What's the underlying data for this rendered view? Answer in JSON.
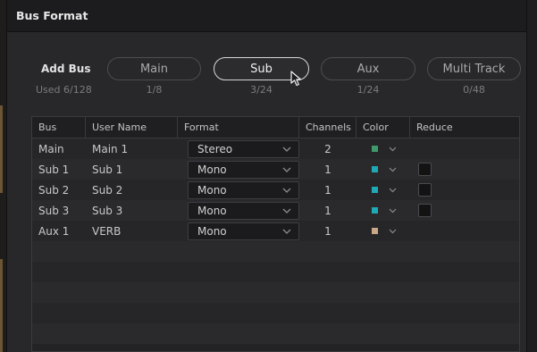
{
  "window": {
    "title": "Bus Format"
  },
  "add_bus": {
    "label": "Add Bus",
    "used": "Used 6/128",
    "buttons": [
      {
        "label": "Main",
        "count": "1/8",
        "active": false
      },
      {
        "label": "Sub",
        "count": "3/24",
        "active": true
      },
      {
        "label": "Aux",
        "count": "1/24",
        "active": false
      },
      {
        "label": "Multi Track",
        "count": "0/48",
        "active": false
      }
    ]
  },
  "table": {
    "headers": [
      "Bus",
      "User Name",
      "Format",
      "Channels",
      "Color",
      "Reduce"
    ],
    "rows": [
      {
        "bus": "Main",
        "user_name": "Main 1",
        "format": "Stereo",
        "channels": "2",
        "color": "#3f9a6a",
        "reduce": false
      },
      {
        "bus": "Sub 1",
        "user_name": "Sub 1",
        "format": "Mono",
        "channels": "1",
        "color": "#1fa9b4",
        "reduce": true
      },
      {
        "bus": "Sub 2",
        "user_name": "Sub 2",
        "format": "Mono",
        "channels": "1",
        "color": "#1fa9b4",
        "reduce": true
      },
      {
        "bus": "Sub 3",
        "user_name": "Sub 3",
        "format": "Mono",
        "channels": "1",
        "color": "#1fa9b4",
        "reduce": true
      },
      {
        "bus": "Aux 1",
        "user_name": "VERB",
        "format": "Mono",
        "channels": "1",
        "color": "#c8a886",
        "reduce": false
      }
    ]
  },
  "icons": {
    "dropdown": "chevron-down-icon",
    "cursor": "mouse-pointer-icon"
  }
}
